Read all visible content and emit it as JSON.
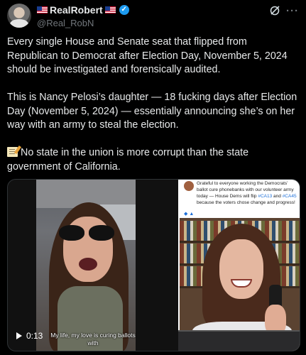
{
  "author": {
    "display_name": "RealRobert",
    "handle": "@Real_RobN",
    "verified_badge_color": "#1d9bf0",
    "name_flags": [
      "us-flag-icon",
      "us-flag-icon"
    ]
  },
  "header_icons": [
    "grok-icon",
    "more-options-icon"
  ],
  "post": {
    "paragraph_1": "Every single House and Senate seat that flipped from Republican to Democrat after Election Day, November 5, 2024 should be investigated and forensically audited.",
    "paragraph_2": "This is Nancy Pelosi’s daughter — 18 fucking days after Election Day (November 5, 2024) — essentially announcing she’s on her way with an army to steal the election.",
    "paragraph_3_icon": "memo-icon",
    "paragraph_3": "No state in the union is more corrupt than the state government of California."
  },
  "media": {
    "embedded_tweet_part1": "Grateful to everyone working the Democrats’ ballot cure phonebanks with our volunteer army today — House Dems will flip ",
    "embedded_tweet_tag1": "#CA13",
    "embedded_tweet_and": " and ",
    "embedded_tweet_tag2": "#CA45",
    "embedded_tweet_part2": " because the voters chose change and progress!",
    "time": "0:13",
    "caption": "My life, my love is curing ballots with"
  }
}
